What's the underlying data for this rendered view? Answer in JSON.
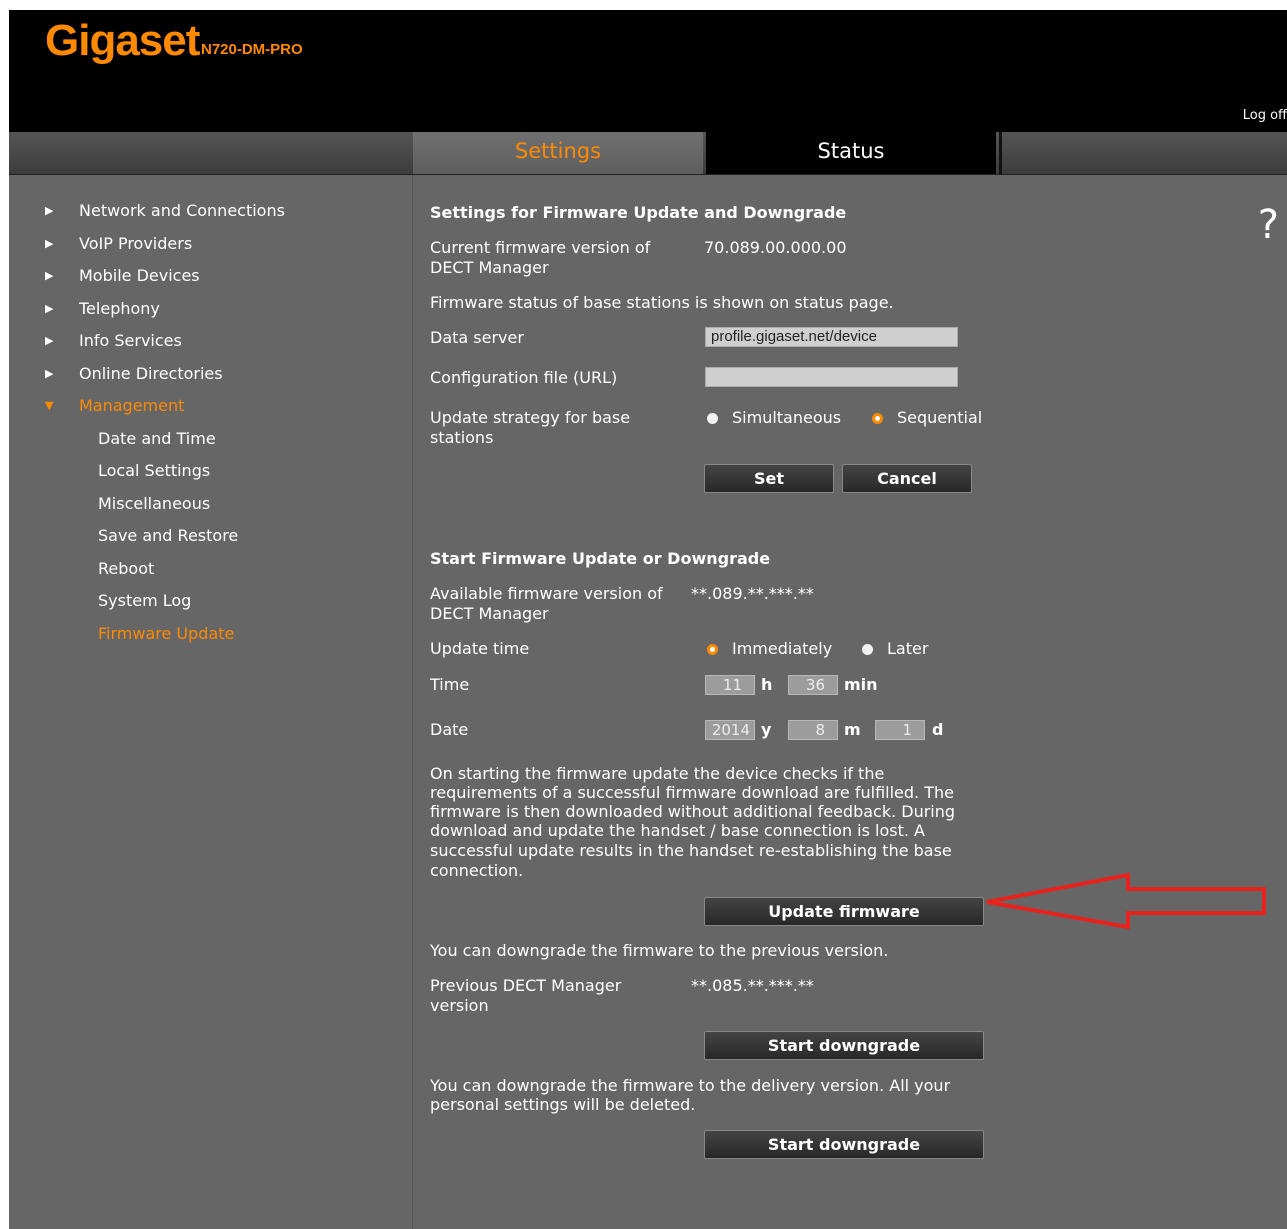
{
  "header": {
    "logo": "Gigaset",
    "model": "N720-DM-PRO",
    "logoff": "Log off"
  },
  "tabs": {
    "settings": "Settings",
    "status": "Status"
  },
  "sidebar": {
    "items": [
      {
        "label": "Network and Connections",
        "arrow": "▶"
      },
      {
        "label": "VoIP Providers",
        "arrow": "▶"
      },
      {
        "label": "Mobile Devices",
        "arrow": "▶"
      },
      {
        "label": "Telephony",
        "arrow": "▶"
      },
      {
        "label": "Info Services",
        "arrow": "▶"
      },
      {
        "label": "Online Directories",
        "arrow": "▶"
      },
      {
        "label": "Management",
        "arrow": "▼"
      }
    ],
    "subitems": [
      {
        "label": "Date and Time"
      },
      {
        "label": "Local Settings"
      },
      {
        "label": "Miscellaneous"
      },
      {
        "label": "Save and Restore"
      },
      {
        "label": "Reboot"
      },
      {
        "label": "System Log"
      },
      {
        "label": "Firmware Update"
      }
    ]
  },
  "help": "?",
  "settings_section": {
    "title": "Settings for Firmware Update and Downgrade",
    "current_label_1": "Current firmware version of",
    "current_label_2": "DECT Manager",
    "current_value": "70.089.00.000.00",
    "status_note": "Firmware status of base stations is shown on status page.",
    "data_server_label": "Data server",
    "data_server_value": "profile.gigaset.net/device",
    "config_file_label": "Configuration file (URL)",
    "config_file_value": "",
    "strategy_label_1": "Update strategy for base",
    "strategy_label_2": "stations",
    "strategy_option_1": "Simultaneous",
    "strategy_option_2": "Sequential",
    "strategy_selected": "Sequential",
    "set_button": "Set",
    "cancel_button": "Cancel"
  },
  "update_section": {
    "title": "Start Firmware Update or Downgrade",
    "available_label_1": "Available firmware version of",
    "available_label_2": "DECT Manager",
    "available_value": "**.089.**.***.**",
    "time_label": "Update time",
    "time_option_1": "Immediately",
    "time_option_2": "Later",
    "time_selected": "Immediately",
    "time_field_label": "Time",
    "hour": "11",
    "hour_unit": "h",
    "minute": "36",
    "minute_unit": "min",
    "date_label": "Date",
    "year": "2014",
    "year_unit": "y",
    "month": "8",
    "month_unit": "m",
    "day": "1",
    "day_unit": "d",
    "info_lines": [
      "On starting the firmware update the device checks if the",
      "requirements of a successful firmware download are fulfilled. The",
      "firmware is then downloaded without additional feedback. During",
      "download and update the handset / base connection is lost. A",
      "successful update results in the handset re-establishing the base",
      "connection."
    ],
    "update_button": "Update firmware",
    "downgrade_note": "You can downgrade the firmware to the previous version.",
    "previous_label_1": "Previous DECT Manager",
    "previous_label_2": "version",
    "previous_value": "**.085.**.***.**",
    "downgrade_button": "Start downgrade",
    "delivery_note_1": "You can downgrade the firmware to the delivery version. All your",
    "delivery_note_2": "personal settings will be deleted.",
    "delivery_button": "Start downgrade"
  },
  "annotation": {
    "arrow_color": "#e8231e"
  }
}
